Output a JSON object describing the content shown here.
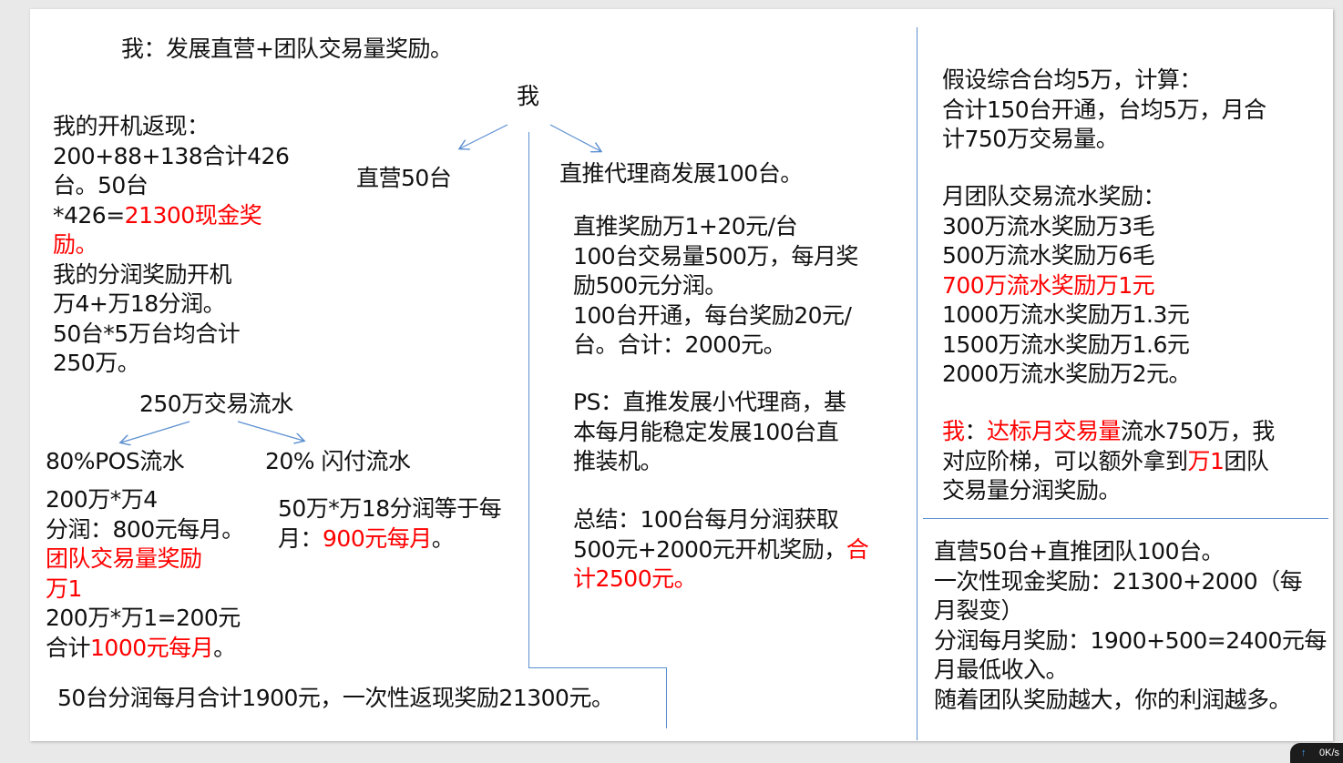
{
  "title": "我：发展直营+团队交易量奖励。",
  "root_label": "我",
  "direct_label": "直营50台",
  "agent_label": "直推代理商发展100台。",
  "left": {
    "lines": [
      [
        {
          "t": "我的开机返现："
        }
      ],
      [
        {
          "t": "200+88+138合计426"
        }
      ],
      [
        {
          "t": "台。50台"
        }
      ],
      [
        {
          "t": "*426="
        },
        {
          "t": "21300现金奖",
          "red": true
        }
      ],
      [
        {
          "t": "励。",
          "red": true
        }
      ],
      [
        {
          "t": "我的分润奖励开机"
        }
      ],
      [
        {
          "t": "万4+万18分润。"
        }
      ],
      [
        {
          "t": "50台*5万台均合计"
        }
      ],
      [
        {
          "t": "250万。"
        }
      ]
    ]
  },
  "flow_label": "250万交易流水",
  "pos_label": "80%POS流水",
  "flash_label": "20% 闪付流水",
  "pos": {
    "lines": [
      [
        {
          "t": "200万*万4"
        }
      ],
      [
        {
          "t": "分润：800元每月。"
        }
      ],
      [
        {
          "t": "团队交易量奖励",
          "red": true
        }
      ],
      [
        {
          "t": "万1",
          "red": true
        }
      ],
      [
        {
          "t": "200万*万1=200元"
        }
      ],
      [
        {
          "t": "合计"
        },
        {
          "t": "1000元每月",
          "red": true
        },
        {
          "t": "。"
        }
      ]
    ]
  },
  "flash": {
    "lines": [
      [
        {
          "t": "50万*万18分润等于每"
        }
      ],
      [
        {
          "t": "月："
        },
        {
          "t": "900元每月",
          "red": true
        },
        {
          "t": "。"
        }
      ]
    ]
  },
  "bottom_summary": "50台分润每月合计1900元，一次性返现奖励21300元。",
  "agent_detail": {
    "lines": [
      [
        {
          "t": "直推奖励万1+20元/台"
        }
      ],
      [
        {
          "t": "100台交易量500万，每月奖"
        }
      ],
      [
        {
          "t": "励500元分润。"
        }
      ],
      [
        {
          "t": "100台开通，每台奖励20元/"
        }
      ],
      [
        {
          "t": "台。合计：2000元。"
        }
      ]
    ]
  },
  "agent_ps": {
    "lines": [
      [
        {
          "t": "PS：直推发展小代理商，基"
        }
      ],
      [
        {
          "t": "本每月能稳定发展100台直"
        }
      ],
      [
        {
          "t": "推装机。"
        }
      ]
    ]
  },
  "agent_summary": {
    "lines": [
      [
        {
          "t": "总结：100台每月分润获取"
        }
      ],
      [
        {
          "t": "500元+2000元开机奖励，"
        },
        {
          "t": "合",
          "red": true
        }
      ],
      [
        {
          "t": "计2500元。",
          "red": true
        }
      ]
    ]
  },
  "assume": {
    "lines": [
      [
        {
          "t": "假设综合台均5万，计算："
        }
      ],
      [
        {
          "t": "合计150台开通，台均5万，月合"
        }
      ],
      [
        {
          "t": "计750万交易量。"
        }
      ]
    ]
  },
  "tiers": {
    "lines": [
      [
        {
          "t": "月团队交易流水奖励："
        }
      ],
      [
        {
          "t": "300万流水奖励万3毛"
        }
      ],
      [
        {
          "t": "500万流水奖励万6毛"
        }
      ],
      [
        {
          "t": "700万流水奖励万1元",
          "red": true
        }
      ],
      [
        {
          "t": "1000万流水奖励万1.3元"
        }
      ],
      [
        {
          "t": "1500万流水奖励万1.6元"
        }
      ],
      [
        {
          "t": "2000万流水奖励万2元。"
        }
      ]
    ]
  },
  "target": {
    "lines": [
      [
        {
          "t": "我",
          "red": true
        },
        {
          "t": "："
        },
        {
          "t": "达标月交易量",
          "red": true
        },
        {
          "t": "流水750万，我"
        }
      ],
      [
        {
          "t": "对应阶梯，可以额外拿到"
        },
        {
          "t": "万1",
          "red": true
        },
        {
          "t": "团队"
        }
      ],
      [
        {
          "t": "交易量分润奖励。"
        }
      ]
    ]
  },
  "final": {
    "lines": [
      [
        {
          "t": "直营50台+直推团队100台。"
        }
      ],
      [
        {
          "t": "一次性现金奖励：21300+2000（每"
        }
      ],
      [
        {
          "t": "月裂变）"
        }
      ],
      [
        {
          "t": "分润每月奖励：1900+500=2400元每"
        }
      ],
      [
        {
          "t": "月最低收入。"
        }
      ],
      [
        {
          "t": "随着团队奖励越大，你的利润越多。"
        }
      ]
    ]
  },
  "net_speed": "0K/s",
  "colors": {
    "accent_red": "#ff0000",
    "line_blue": "#5b8fd0",
    "text": "#111111"
  }
}
